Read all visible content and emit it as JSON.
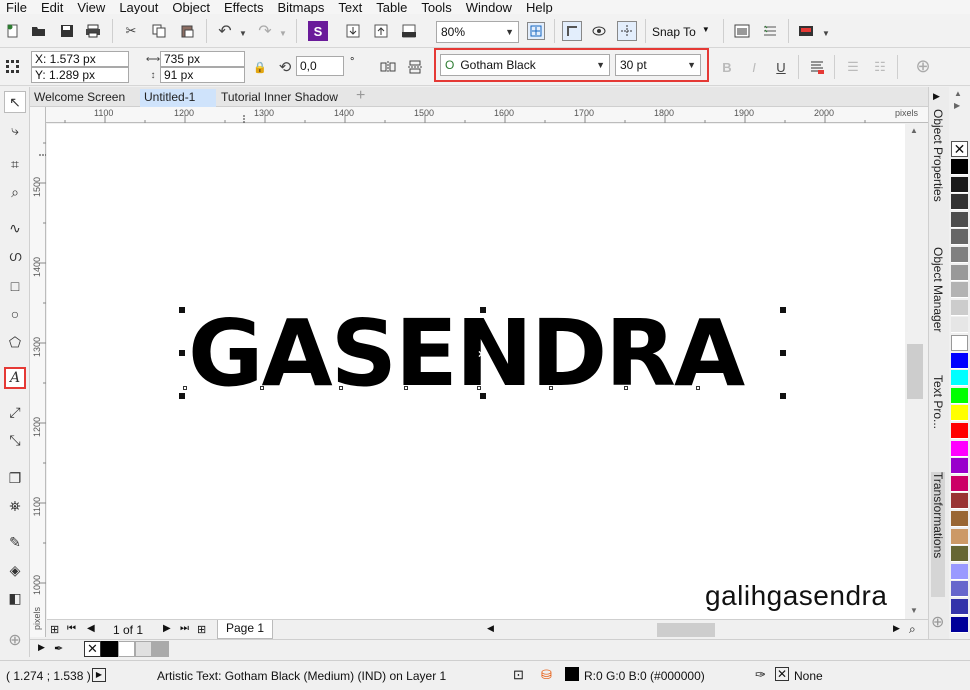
{
  "menu": [
    "File",
    "Edit",
    "View",
    "Layout",
    "Object",
    "Effects",
    "Bitmaps",
    "Text",
    "Table",
    "Tools",
    "Window",
    "Help"
  ],
  "standard_toolbar": {
    "zoom": "80%",
    "snap_to": "Snap To"
  },
  "property_bar": {
    "x": "X: 1.573 px",
    "y": "Y: 1.289 px",
    "width": "735 px",
    "height": "91 px",
    "rotation": "0,0",
    "degree_symbol": "°",
    "font_name": "Gotham Black",
    "font_size": "30 pt",
    "highlight_color": "#e53935"
  },
  "doc_tabs": [
    "Welcome Screen",
    "Untitled-1",
    "Tutorial Inner Shadow"
  ],
  "active_tab": "Untitled-1",
  "ruler": {
    "h_labels": [
      "1100",
      "1200",
      "1300",
      "1400",
      "1500",
      "1600",
      "1700",
      "1800",
      "1900",
      "2000"
    ],
    "h_unit": "pixels",
    "v_labels": [
      "1500",
      "1400",
      "1300",
      "1200",
      "1100",
      "1000"
    ],
    "v_unit": "pixels"
  },
  "canvas": {
    "main_text": "GASENDRA",
    "watermark": "galihgasendra"
  },
  "dockers": [
    "Object Properties",
    "Object Manager",
    "Text Pro...",
    "Transformations"
  ],
  "palette_colors": [
    "#000000",
    "#1a1a1a",
    "#333333",
    "#4d4d4d",
    "#666666",
    "#808080",
    "#999999",
    "#b3b3b3",
    "#cccccc",
    "#e6e6e6",
    "#ffffff",
    "#0000ff",
    "#00ffff",
    "#00ff00",
    "#ffff00",
    "#ff0000",
    "#ff00ff",
    "#9900cc",
    "#cc0066",
    "#993333",
    "#996633",
    "#cc9966",
    "#666633",
    "#9999ff",
    "#6666cc",
    "#3333aa",
    "#000099"
  ],
  "page_nav": {
    "counter": "1 of 1",
    "page_tab": "Page 1"
  },
  "status": {
    "coords": "( 1.274 ; 1.538 )",
    "info": "Artistic Text: Gotham Black (Medium) (IND) on Layer 1",
    "fill": "R:0 G:0 B:0 (#000000)",
    "outline": "None"
  }
}
